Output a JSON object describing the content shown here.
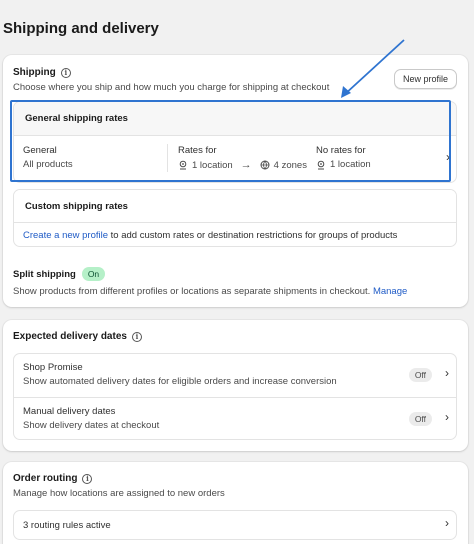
{
  "page": {
    "title": "Shipping and delivery"
  },
  "shipping": {
    "title": "Shipping",
    "description": "Choose where you ship and how much you charge for shipping at checkout",
    "new_profile_label": "New profile",
    "general_rates": {
      "header": "General shipping rates",
      "profile_name": "General",
      "profile_sub": "All products",
      "rates_for_label": "Rates for",
      "rates_locations": "1 location",
      "rates_zones": "4 zones",
      "no_rates_label": "No rates for",
      "no_rates_locations": "1 location"
    },
    "custom_rates": {
      "header": "Custom shipping rates",
      "link_text": "Create a new profile",
      "body_text": " to add custom rates or destination restrictions for groups of products"
    },
    "split": {
      "title": "Split shipping",
      "badge": "On",
      "description": "Show products from different profiles or locations as separate shipments in checkout.",
      "manage_link": "Manage"
    }
  },
  "delivery": {
    "title": "Expected delivery dates",
    "items": [
      {
        "title": "Shop Promise",
        "description": "Show automated delivery dates for eligible orders and increase conversion",
        "status": "Off"
      },
      {
        "title": "Manual delivery dates",
        "description": "Show delivery dates at checkout",
        "status": "Off"
      }
    ]
  },
  "routing": {
    "title": "Order routing",
    "description": "Manage how locations are assigned to new orders",
    "rules": "3 routing rules active"
  },
  "colors": {
    "accent": "#2f74d0",
    "link": "#1f5bc6",
    "on_badge": "#b5f0c8"
  }
}
